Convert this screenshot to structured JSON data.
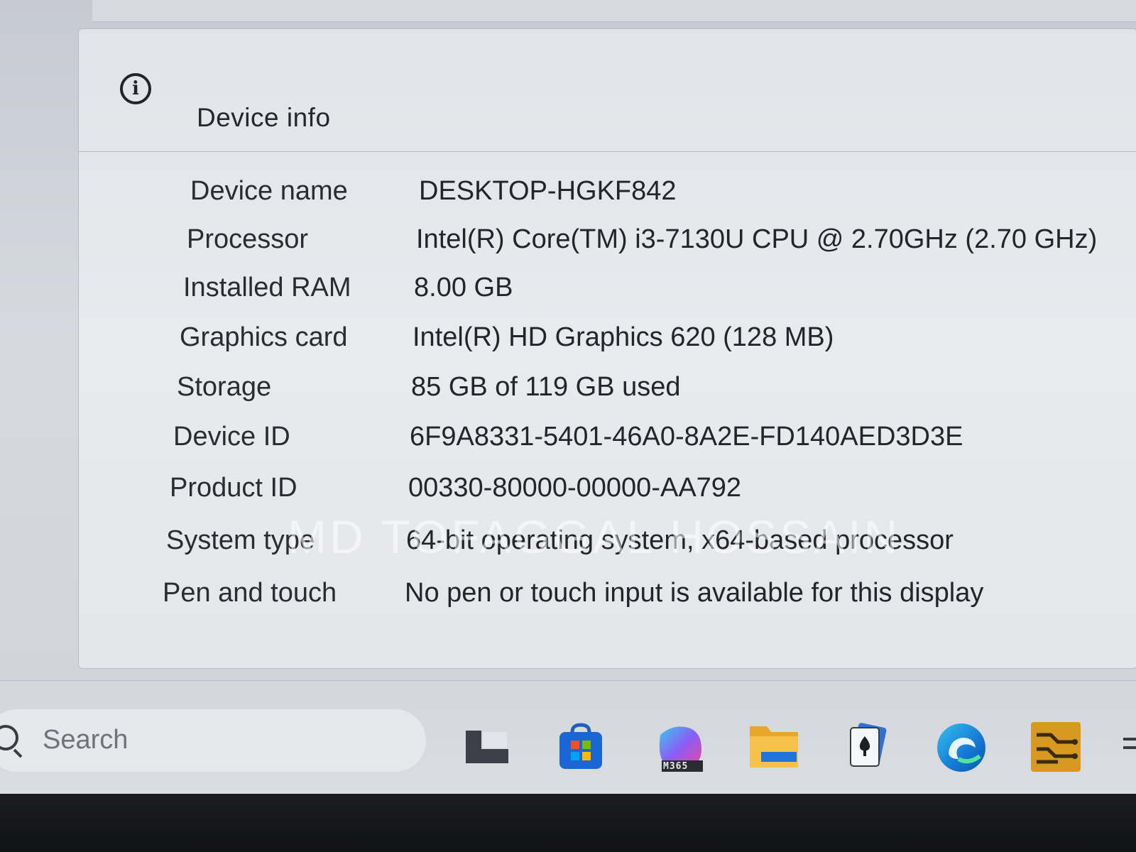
{
  "header": {
    "icon": "info-icon",
    "title": "Device info"
  },
  "specs": [
    {
      "label": "Device name",
      "value": "DESKTOP-HGKF842"
    },
    {
      "label": "Processor",
      "value": "Intel(R) Core(TM) i3-7130U CPU @ 2.70GHz (2.70 GHz)"
    },
    {
      "label": "Installed RAM",
      "value": "8.00 GB"
    },
    {
      "label": "Graphics card",
      "value": "Intel(R) HD Graphics 620 (128 MB)"
    },
    {
      "label": "Storage",
      "value": "85 GB of 119 GB used"
    },
    {
      "label": "Device ID",
      "value": "6F9A8331-5401-46A0-8A2E-FD140AED3D3E"
    },
    {
      "label": "Product ID",
      "value": "00330-80000-00000-AA792"
    },
    {
      "label": "System type",
      "value": "64-bit operating system, x64-based processor"
    },
    {
      "label": "Pen and touch",
      "value": "No pen or touch input is available for this display"
    }
  ],
  "watermark": "MD TOFAGGAL HOSSAIN",
  "taskbar": {
    "search_placeholder": "Search",
    "m365_badge": "M365",
    "apps": [
      "task-view-icon",
      "microsoft-store-icon",
      "microsoft-365-icon",
      "file-explorer-icon",
      "solitaire-icon",
      "edge-icon",
      "circuit-app-icon"
    ]
  }
}
